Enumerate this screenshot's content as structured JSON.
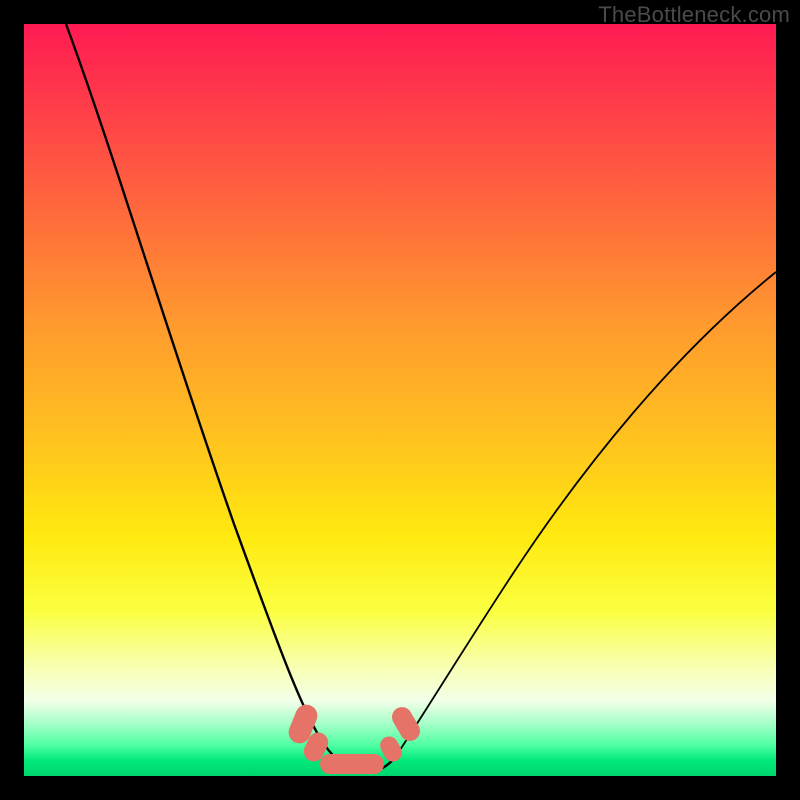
{
  "watermark": "TheBottleneck.com",
  "colors": {
    "frame": "#000000",
    "gradient_top": "#ff1a52",
    "gradient_mid": "#ffe90f",
    "gradient_bottom": "#00d66e",
    "curve": "#000000",
    "marker": "#e57368"
  },
  "chart_data": {
    "type": "line",
    "title": "",
    "xlabel": "",
    "ylabel": "",
    "xlim": [
      0,
      100
    ],
    "ylim": [
      0,
      100
    ],
    "note": "No axes/ticks/legend shown. Values are estimated from the image: x is horizontal position (0=left,100=right), y is height above bottom (0=bottom,100=top). Curve resembles an asymmetric V with a flat basin near x≈38–48.",
    "series": [
      {
        "name": "curve",
        "x": [
          5,
          8,
          12,
          17,
          22,
          27,
          31,
          35,
          38,
          42,
          46,
          50,
          55,
          60,
          65,
          72,
          80,
          90,
          100
        ],
        "y": [
          100,
          88,
          74,
          60,
          46,
          33,
          22,
          12,
          4,
          1,
          1,
          4,
          10,
          18,
          26,
          36,
          47,
          58,
          67
        ]
      }
    ],
    "markers": {
      "name": "bottom-cluster",
      "description": "Rounded salmon-colored blobs clustered at the valley of the curve near the bottom green band.",
      "approx_points": [
        {
          "x": 36,
          "y": 6
        },
        {
          "x": 38,
          "y": 3
        },
        {
          "x": 42,
          "y": 1
        },
        {
          "x": 46,
          "y": 1
        },
        {
          "x": 49,
          "y": 3
        },
        {
          "x": 51,
          "y": 6
        }
      ]
    }
  }
}
